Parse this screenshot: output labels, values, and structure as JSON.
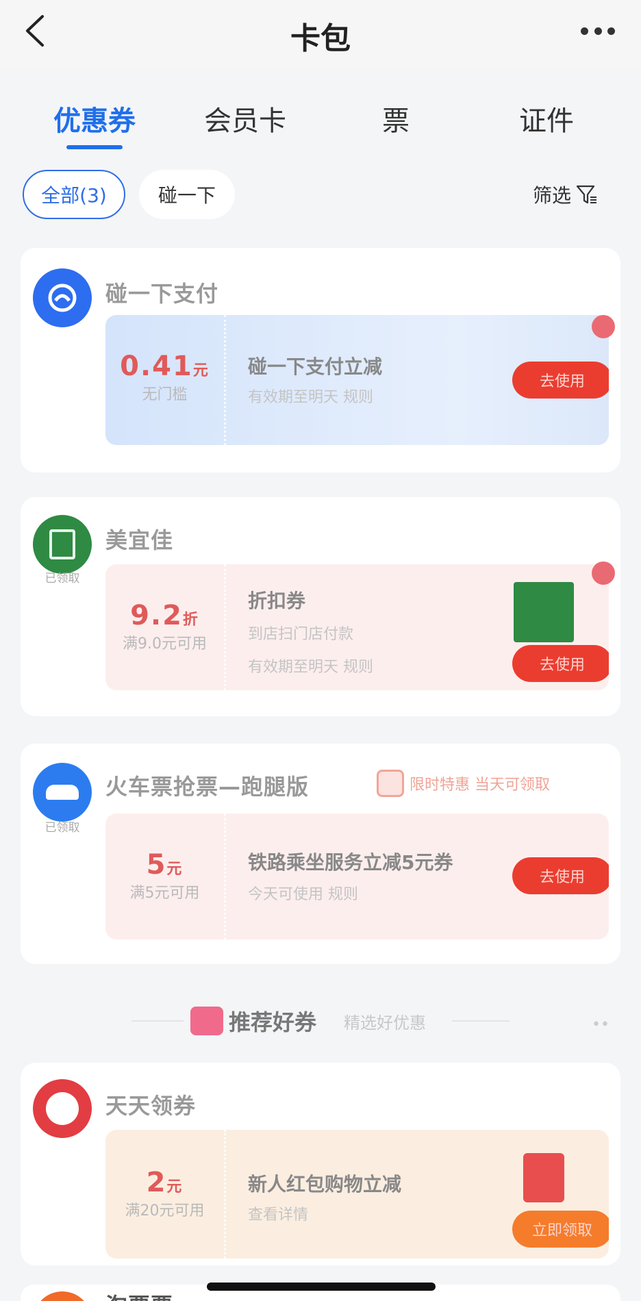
{
  "navbar": {
    "title": "卡包"
  },
  "tabs": [
    {
      "label": "优惠券",
      "active": true
    },
    {
      "label": "会员卡",
      "active": false
    },
    {
      "label": "票",
      "active": false
    },
    {
      "label": "证件",
      "active": false
    }
  ],
  "filters": {
    "all_label": "全部(3)",
    "bump_label": "碰一下",
    "filter_label": "筛选"
  },
  "cards": [
    {
      "merchant": "碰一下支付",
      "amount": "0.41",
      "amount_unit": "元",
      "condition": "无门槛",
      "title": "碰一下支付立减",
      "subtitle": "有效期至明天   规则",
      "button": "去使用",
      "colors": {
        "coupon_bg": "#dbe8fb",
        "logo": "#2d6df0"
      }
    },
    {
      "merchant": "美宜佳",
      "logo_caption": "已领取",
      "amount": "9.2",
      "amount_unit": "折",
      "condition": "满9.0元可用",
      "title": "折扣券",
      "subtitle": "到店扫门店付款",
      "subtitle2": "有效期至明天   规则",
      "button": "去使用",
      "colors": {
        "coupon_bg": "#fdeeee",
        "logo": "#2f8a43"
      }
    },
    {
      "merchant": "火车票抢票—跑腿版",
      "logo_caption": "已领取",
      "promo": "限时特惠 当天可领取",
      "amount": "5",
      "amount_unit": "元",
      "condition": "满5元可用",
      "title": "铁路乘坐服务立减5元券",
      "subtitle": "今天可使用   规则",
      "button": "去使用",
      "colors": {
        "coupon_bg": "#fdeeee",
        "logo": "#2c7cf0"
      }
    }
  ],
  "recommend": {
    "title": "推荐好券",
    "subtitle": "精选好优惠"
  },
  "card4": {
    "merchant": "天天领券",
    "amount": "2",
    "amount_unit": "元",
    "condition": "满20元可用",
    "title": "新人红包购物立减",
    "subtitle": "查看详情",
    "button": "立即领取",
    "colors": {
      "coupon_bg": "#fbeee0",
      "logo": "#e23d42"
    }
  },
  "card5": {
    "merchant": "淘票票"
  }
}
